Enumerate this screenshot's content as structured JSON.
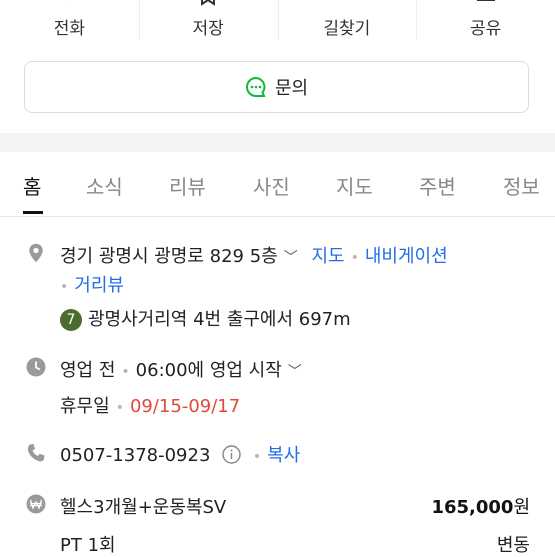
{
  "actions": [
    {
      "label": "전화",
      "icon": "phone-icon"
    },
    {
      "label": "저장",
      "icon": "bookmark-icon"
    },
    {
      "label": "길찾기",
      "icon": "directions-icon"
    },
    {
      "label": "공유",
      "icon": "share-icon"
    }
  ],
  "ask": {
    "label": "문의",
    "icon": "chat-icon",
    "icon_color": "#10b93b"
  },
  "tabs": [
    "홈",
    "소식",
    "리뷰",
    "사진",
    "지도",
    "주변",
    "정보"
  ],
  "active_tab": "홈",
  "address": {
    "text": "경기 광명시 광명로 829 5층",
    "links": [
      "지도",
      "내비게이션",
      "거리뷰"
    ]
  },
  "subway": {
    "line": "7",
    "line_color": "#4c6b2d",
    "text": "광명사거리역 4번 출구에서 697m"
  },
  "hours": {
    "status": "영업 전",
    "detail": "06:00에 영업 시작",
    "holiday_label": "휴무일",
    "holiday_dates": "09/15-09/17"
  },
  "phone": {
    "number": "0507-1378-0923",
    "copy_label": "복사"
  },
  "menu": [
    {
      "name": "헬스3개월+운동복SV",
      "price": "165,000",
      "unit": "원"
    },
    {
      "name": "PT 1회",
      "price": "변동"
    }
  ],
  "colors": {
    "link": "#1f6fe5",
    "holiday": "#e0483c"
  }
}
